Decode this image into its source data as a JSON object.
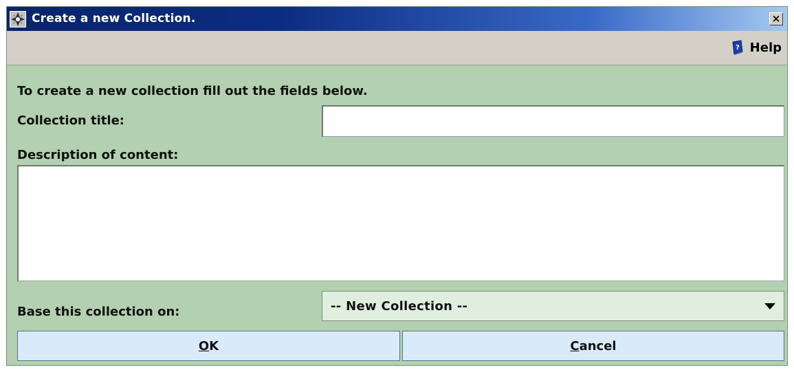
{
  "window": {
    "title": "Create a new Collection.",
    "close_glyph": "×",
    "app_icon": "app-icon"
  },
  "toolbar": {
    "help_label": "Help",
    "help_icon": "help-book-icon"
  },
  "form": {
    "intro_text": "To create a new collection fill out the fields below.",
    "title_label": "Collection title:",
    "title_value": "",
    "description_label": "Description of content:",
    "description_value": "",
    "base_label": "Base this collection on:",
    "base_selected": "-- New Collection --"
  },
  "buttons": {
    "ok_mnemonic": "O",
    "ok_rest": "K",
    "cancel_mnemonic": "C",
    "cancel_rest": "ancel"
  },
  "colors": {
    "title_bar_start": "#0a246a",
    "title_bar_end": "#a6caf0",
    "dialog_background": "#b3d1b0",
    "button_background": "#d9eaf9",
    "select_background": "#dfeede"
  }
}
